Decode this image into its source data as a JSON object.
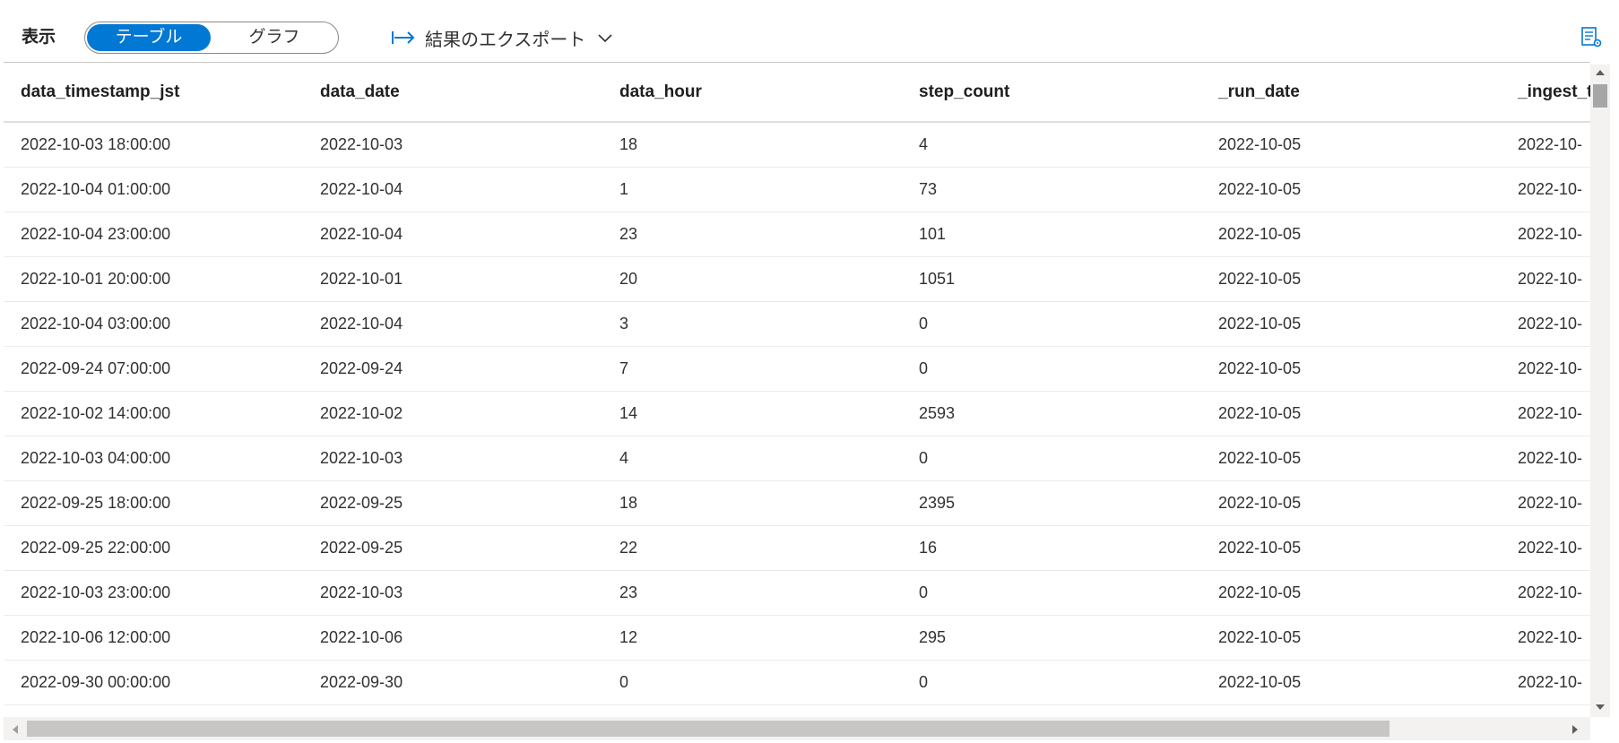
{
  "toolbar": {
    "view_label": "表示",
    "toggle": {
      "table_label": "テーブル",
      "graph_label": "グラフ"
    },
    "export_label": "結果のエクスポート",
    "icons": {
      "export": "export-arrow-icon",
      "chevron": "chevron-down-icon",
      "settings": "column-settings-icon"
    }
  },
  "colors": {
    "accent": "#0078d4"
  },
  "table": {
    "columns": [
      "data_timestamp_jst",
      "data_date",
      "data_hour",
      "step_count",
      "_run_date",
      "_ingest_ti"
    ],
    "rows": [
      [
        "2022-10-03 18:00:00",
        "2022-10-03",
        "18",
        "4",
        "2022-10-05",
        "2022-10-"
      ],
      [
        "2022-10-04 01:00:00",
        "2022-10-04",
        "1",
        "73",
        "2022-10-05",
        "2022-10-"
      ],
      [
        "2022-10-04 23:00:00",
        "2022-10-04",
        "23",
        "101",
        "2022-10-05",
        "2022-10-"
      ],
      [
        "2022-10-01 20:00:00",
        "2022-10-01",
        "20",
        "1051",
        "2022-10-05",
        "2022-10-"
      ],
      [
        "2022-10-04 03:00:00",
        "2022-10-04",
        "3",
        "0",
        "2022-10-05",
        "2022-10-"
      ],
      [
        "2022-09-24 07:00:00",
        "2022-09-24",
        "7",
        "0",
        "2022-10-05",
        "2022-10-"
      ],
      [
        "2022-10-02 14:00:00",
        "2022-10-02",
        "14",
        "2593",
        "2022-10-05",
        "2022-10-"
      ],
      [
        "2022-10-03 04:00:00",
        "2022-10-03",
        "4",
        "0",
        "2022-10-05",
        "2022-10-"
      ],
      [
        "2022-09-25 18:00:00",
        "2022-09-25",
        "18",
        "2395",
        "2022-10-05",
        "2022-10-"
      ],
      [
        "2022-09-25 22:00:00",
        "2022-09-25",
        "22",
        "16",
        "2022-10-05",
        "2022-10-"
      ],
      [
        "2022-10-03 23:00:00",
        "2022-10-03",
        "23",
        "0",
        "2022-10-05",
        "2022-10-"
      ],
      [
        "2022-10-06 12:00:00",
        "2022-10-06",
        "12",
        "295",
        "2022-10-05",
        "2022-10-"
      ],
      [
        "2022-09-30 00:00:00",
        "2022-09-30",
        "0",
        "0",
        "2022-10-05",
        "2022-10-"
      ]
    ]
  }
}
